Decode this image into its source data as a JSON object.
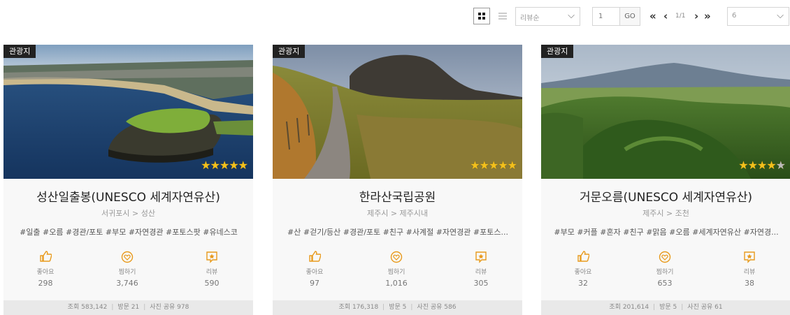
{
  "toolbar": {
    "sort_value": "리뷰순",
    "page_input": "1",
    "go_label": "GO",
    "first_label": "«",
    "prev_label": "‹",
    "page_indicator": "1/1",
    "next_label": "›",
    "last_label": "»",
    "per_page_value": "6",
    "chevron": "⌵"
  },
  "cards": [
    {
      "tag": "관광지",
      "title": "성산일출봉(UNESCO 세계자연유산)",
      "location": "서귀포시 > 성산",
      "tags": "#일출 #오름 #경관/포토 #부모 #자연경관 #포토스팟 #유네스코",
      "rating": 5,
      "like_label": "좋아요",
      "like_count": "298",
      "pick_label": "찜하기",
      "pick_count": "3,746",
      "review_label": "리뷰",
      "review_count": "590",
      "views": "조회 583,142",
      "visits": "방문 21",
      "photos": "사진 공유 978"
    },
    {
      "tag": "관광지",
      "title": "한라산국립공원",
      "location": "제주시 > 제주시내",
      "tags": "#산 #걷기/등산 #경관/포토 #친구 #사계절 #자연경관 #포토스...",
      "rating": 5,
      "like_label": "좋아요",
      "like_count": "97",
      "pick_label": "찜하기",
      "pick_count": "1,016",
      "review_label": "리뷰",
      "review_count": "305",
      "views": "조회 176,318",
      "visits": "방문 5",
      "photos": "사진 공유 586"
    },
    {
      "tag": "관광지",
      "title": "거문오름(UNESCO 세계자연유산)",
      "location": "제주시 > 조천",
      "tags": "#부모 #커플 #혼자 #친구 #맑음 #오름 #세계자연유산 #자연경...",
      "rating": 4,
      "like_label": "좋아요",
      "like_count": "32",
      "pick_label": "찜하기",
      "pick_count": "653",
      "review_label": "리뷰",
      "review_count": "38",
      "views": "조회 201,614",
      "visits": "방문 5",
      "photos": "사진 공유 61"
    }
  ],
  "icons": {
    "like": "thumbs-up-icon",
    "pick": "heart-circle-icon",
    "review": "star-note-icon",
    "grid": "grid-view-icon",
    "list": "list-view-icon"
  },
  "colors": {
    "accent": "#e89a1c",
    "star": "#f3c01c",
    "tag_bg": "#222222",
    "footer_bg": "#e9e9e9"
  }
}
